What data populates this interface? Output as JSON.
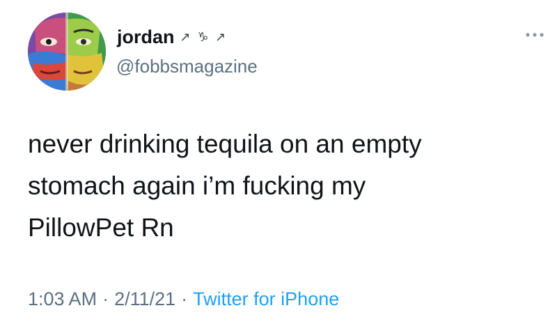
{
  "author": {
    "display_name": "jordan",
    "name_emoji": "↗ ♑ ↗",
    "handle": "@fobbsmagazine",
    "avatar_icon": "painted-portrait-avatar"
  },
  "tweet": {
    "lines": [
      "never drinking tequila on an empty",
      "stomach again i’m fucking my",
      "PillowPet Rn"
    ]
  },
  "meta": {
    "time": "1:03 AM",
    "separator": "·",
    "date": "2/11/21",
    "source": "Twitter for iPhone"
  },
  "colors": {
    "text": "#0f1419",
    "secondary": "#5b7083",
    "link": "#1da1f2",
    "background": "#ffffff"
  },
  "icons": {
    "more": "more-options-icon"
  }
}
